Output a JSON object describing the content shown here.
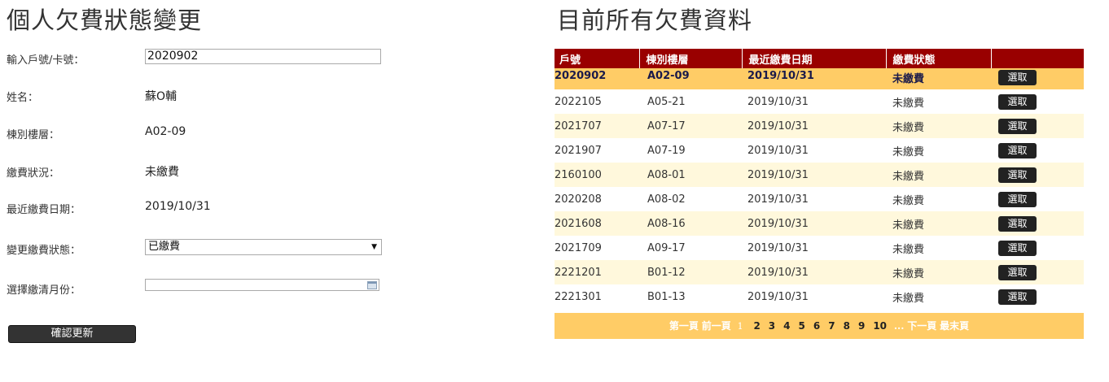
{
  "left_panel": {
    "title": "個人欠費狀態變更",
    "fields": {
      "household_label": "輸入戶號/卡號：",
      "household_value": "2020902",
      "name_label": "姓名：",
      "name_value": "蘇O輔",
      "building_label": "棟別樓層：",
      "building_value": "A02-09",
      "status_label": "繳費狀況：",
      "status_value": "未繳費",
      "last_payment_label": "最近繳費日期：",
      "last_payment_value": "2019/10/31",
      "change_status_label": "變更繳費狀態：",
      "change_status_value": "已繳費",
      "month_label": "選擇繳清月份：",
      "month_value": ""
    },
    "confirm_label": "確認更新"
  },
  "right_panel": {
    "title": "目前所有欠費資料",
    "columns": [
      "戶號",
      "棟別樓層",
      "最近繳費日期",
      "繳費狀態",
      ""
    ],
    "select_label": "選取",
    "rows": [
      [
        "2020902",
        "A02-09",
        "2019/10/31",
        "未繳費"
      ],
      [
        "2022105",
        "A05-21",
        "2019/10/31",
        "未繳費"
      ],
      [
        "2021707",
        "A07-17",
        "2019/10/31",
        "未繳費"
      ],
      [
        "2021907",
        "A07-19",
        "2019/10/31",
        "未繳費"
      ],
      [
        "2160100",
        "A08-01",
        "2019/10/31",
        "未繳費"
      ],
      [
        "2020208",
        "A08-02",
        "2019/10/31",
        "未繳費"
      ],
      [
        "2021608",
        "A08-16",
        "2019/10/31",
        "未繳費"
      ],
      [
        "2021709",
        "A09-17",
        "2019/10/31",
        "未繳費"
      ],
      [
        "2221201",
        "B01-12",
        "2019/10/31",
        "未繳費"
      ],
      [
        "2221301",
        "B01-13",
        "2019/10/31",
        "未繳費"
      ]
    ],
    "pager": {
      "first": "第一頁",
      "prev": "前一頁",
      "current": "1",
      "pages": [
        "2",
        "3",
        "4",
        "5",
        "6",
        "7",
        "8",
        "9",
        "10"
      ],
      "ellipsis": "...",
      "next": "下一頁",
      "last": "最末頁"
    }
  },
  "colors": {
    "header_bg": "#990000",
    "selected_row": "#ffcc66",
    "odd_row": "#fff8dc",
    "pager_bg": "#ffcc66",
    "button_bg": "#222222"
  }
}
